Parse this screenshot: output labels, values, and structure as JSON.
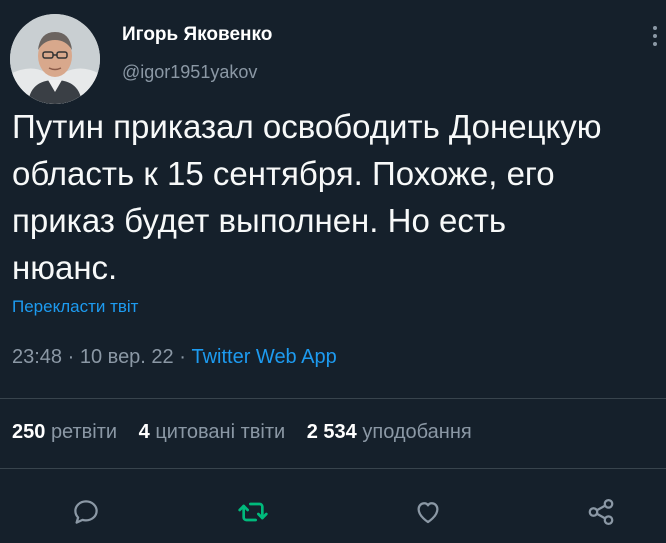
{
  "author": {
    "name": "Игорь Яковенко",
    "handle": "@igor1951yakov"
  },
  "tweet": {
    "text": "Путин приказал освободить Донецкую\nобласть к 15 сентября. Похоже, его\nприказ будет выполнен. Но есть\nнюанс.",
    "translate_label": "Перекласти твіт",
    "time": "23:48",
    "date": "10 вер. 22",
    "source": "Twitter Web App",
    "separator": "·"
  },
  "stats": {
    "retweets_count": "250",
    "retweets_label": "ретвіти",
    "quotes_count": "4",
    "quotes_label": "цитовані твіти",
    "likes_count": "2 534",
    "likes_label": "уподобання"
  },
  "actions": {
    "icons": [
      "reply-icon",
      "retweet-icon",
      "like-icon",
      "share-icon"
    ],
    "retweet_color": "#00ba7c",
    "icon_color": "#8b98a5",
    "link_color": "#1d9bf0"
  }
}
